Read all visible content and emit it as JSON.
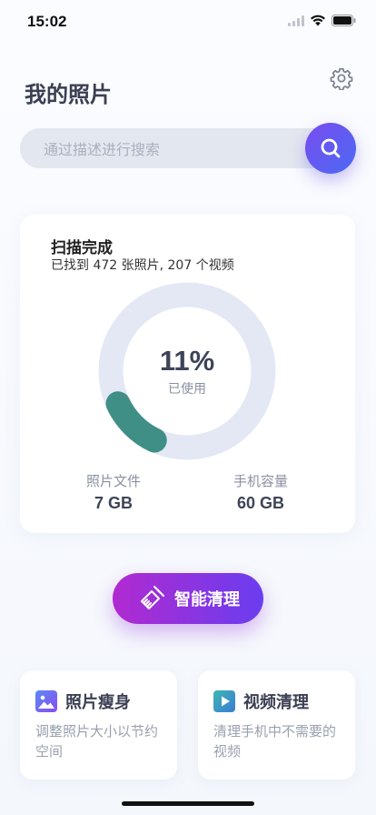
{
  "status_bar": {
    "time": "15:02"
  },
  "header": {
    "title": "我的照片",
    "settings_icon": "gear-icon"
  },
  "search": {
    "placeholder": "通过描述进行搜索",
    "value": "",
    "button_icon": "search-icon"
  },
  "scan": {
    "title": "扫描完成",
    "subtitle": "已找到 472 张照片, 207 个视频",
    "usage_percent_text": "11%",
    "usage_fraction": 0.11,
    "usage_label": "已使用",
    "photos_label": "照片文件",
    "photos_value": "7 GB",
    "phone_label": "手机容量",
    "phone_value": "60 GB"
  },
  "smart_clean": {
    "label": "智能清理",
    "icon": "broom-icon"
  },
  "features": {
    "slim": {
      "title": "照片瘦身",
      "desc": "调整照片大小以节约空间",
      "icon": "image-icon"
    },
    "video": {
      "title": "视频清理",
      "desc": "清理手机中不需要的视频",
      "icon": "video-play-icon"
    }
  },
  "colors": {
    "accent_purple": "#6a3df0",
    "accent_magenta": "#b12ad0",
    "ring_track": "#e3e8f4",
    "ring_fill": "#3f8f86"
  }
}
